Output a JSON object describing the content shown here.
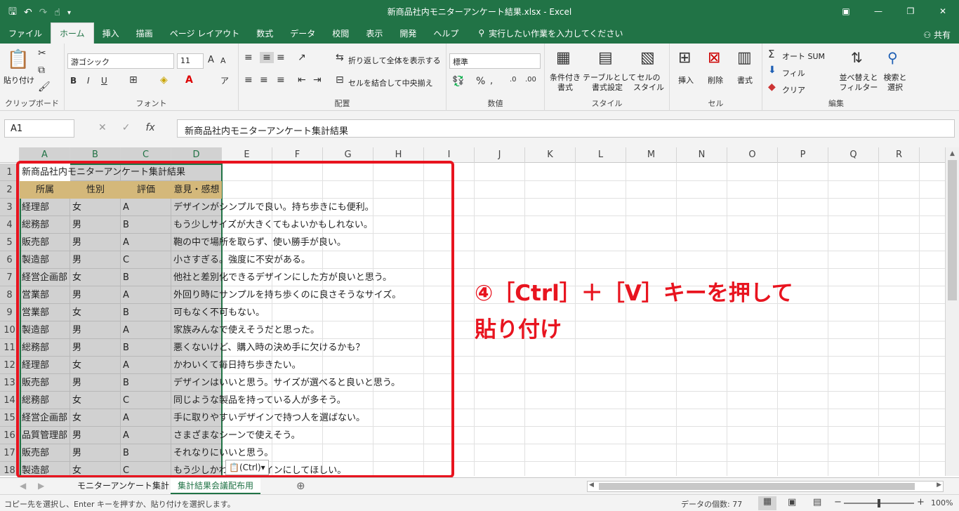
{
  "window": {
    "title": "新商品社内モニターアンケート結果.xlsx  -  Excel",
    "share": "共有"
  },
  "ribbon_tabs": [
    "ファイル",
    "ホーム",
    "挿入",
    "描画",
    "ページ レイアウト",
    "数式",
    "データ",
    "校閲",
    "表示",
    "開発",
    "ヘルプ"
  ],
  "tell_me": "実行したい作業を入力してください",
  "ribbon": {
    "clipboard": {
      "paste": "貼り付け",
      "label": "クリップボード"
    },
    "font": {
      "name": "游ゴシック",
      "size": "11",
      "label": "フォント"
    },
    "alignment": {
      "wrap": "折り返して全体を表示する",
      "merge": "セルを結合して中央揃え",
      "label": "配置"
    },
    "number": {
      "format": "標準",
      "label": "数値"
    },
    "styles": {
      "conditional": [
        "条件付き",
        "書式"
      ],
      "table": [
        "テーブルとして",
        "書式設定"
      ],
      "cellstyle": [
        "セルの",
        "スタイル"
      ],
      "label": "スタイル"
    },
    "cells": {
      "insert": "挿入",
      "delete": "削除",
      "format": "書式",
      "label": "セル"
    },
    "editing": {
      "autosum": "オート SUM",
      "fill": "フィル",
      "clear": "クリア",
      "sort": [
        "並べ替えと",
        "フィルター"
      ],
      "find": [
        "検索と",
        "選択"
      ],
      "label": "編集"
    }
  },
  "formula_bar": {
    "name_box": "A1",
    "content": "新商品社内モニターアンケート集計結果"
  },
  "columns": [
    "A",
    "B",
    "C",
    "D",
    "E",
    "F",
    "G",
    "H",
    "I",
    "J",
    "K",
    "L",
    "M",
    "N",
    "O",
    "P",
    "Q",
    "R"
  ],
  "sheet": {
    "title": "新商品社内モニターアンケート集計結果",
    "headers": [
      "所属",
      "性別",
      "評価",
      "意見・感想"
    ],
    "rows": [
      [
        "経理部",
        "女",
        "A",
        "デザインがシンプルで良い。持ち歩きにも便利。"
      ],
      [
        "総務部",
        "男",
        "B",
        "もう少しサイズが大きくてもよいかもしれない。"
      ],
      [
        "販売部",
        "男",
        "A",
        "鞄の中で場所を取らず、使い勝手が良い。"
      ],
      [
        "製造部",
        "男",
        "C",
        "小さすぎる。強度に不安がある。"
      ],
      [
        "経営企画部",
        "女",
        "B",
        "他社と差別化できるデザインにした方が良いと思う。"
      ],
      [
        "営業部",
        "男",
        "A",
        "外回り時にサンプルを持ち歩くのに良さそうなサイズ。"
      ],
      [
        "営業部",
        "女",
        "B",
        "可もなく不可もない。"
      ],
      [
        "製造部",
        "男",
        "A",
        "家族みんなで使えそうだと思った。"
      ],
      [
        "総務部",
        "男",
        "B",
        "悪くないけど、購入時の決め手に欠けるかも？"
      ],
      [
        "経理部",
        "女",
        "A",
        "かわいくて毎日持ち歩きたい。"
      ],
      [
        "販売部",
        "男",
        "B",
        "デザインはいいと思う。サイズが選べると良いと思う。"
      ],
      [
        "総務部",
        "女",
        "C",
        "同じような製品を持っている人が多そう。"
      ],
      [
        "経営企画部",
        "女",
        "A",
        "手に取りやすいデザインで持つ人を選ばない。"
      ],
      [
        "品質管理部",
        "男",
        "A",
        "さまざまなシーンで使えそう。"
      ],
      [
        "販売部",
        "男",
        "B",
        "それなりにいいと思う。"
      ],
      [
        "製造部",
        "女",
        "C",
        "もう少しかわいいデザインにしてほしい。"
      ]
    ]
  },
  "paste_options": "(Ctrl)",
  "annotation": {
    "line1": "④［Ctrl］＋［V］キーを押して",
    "line2": "貼り付け"
  },
  "sheet_tabs": [
    "モニターアンケート集計",
    "集計結果会議配布用"
  ],
  "status": {
    "message": "コピー先を選択し、Enter キーを押すか、貼り付けを選択します。",
    "count": "データの個数: 77",
    "zoom": "100%"
  },
  "colors": {
    "accent": "#217346",
    "annotation": "#e8141f",
    "header_fill": "#d4b87a"
  }
}
